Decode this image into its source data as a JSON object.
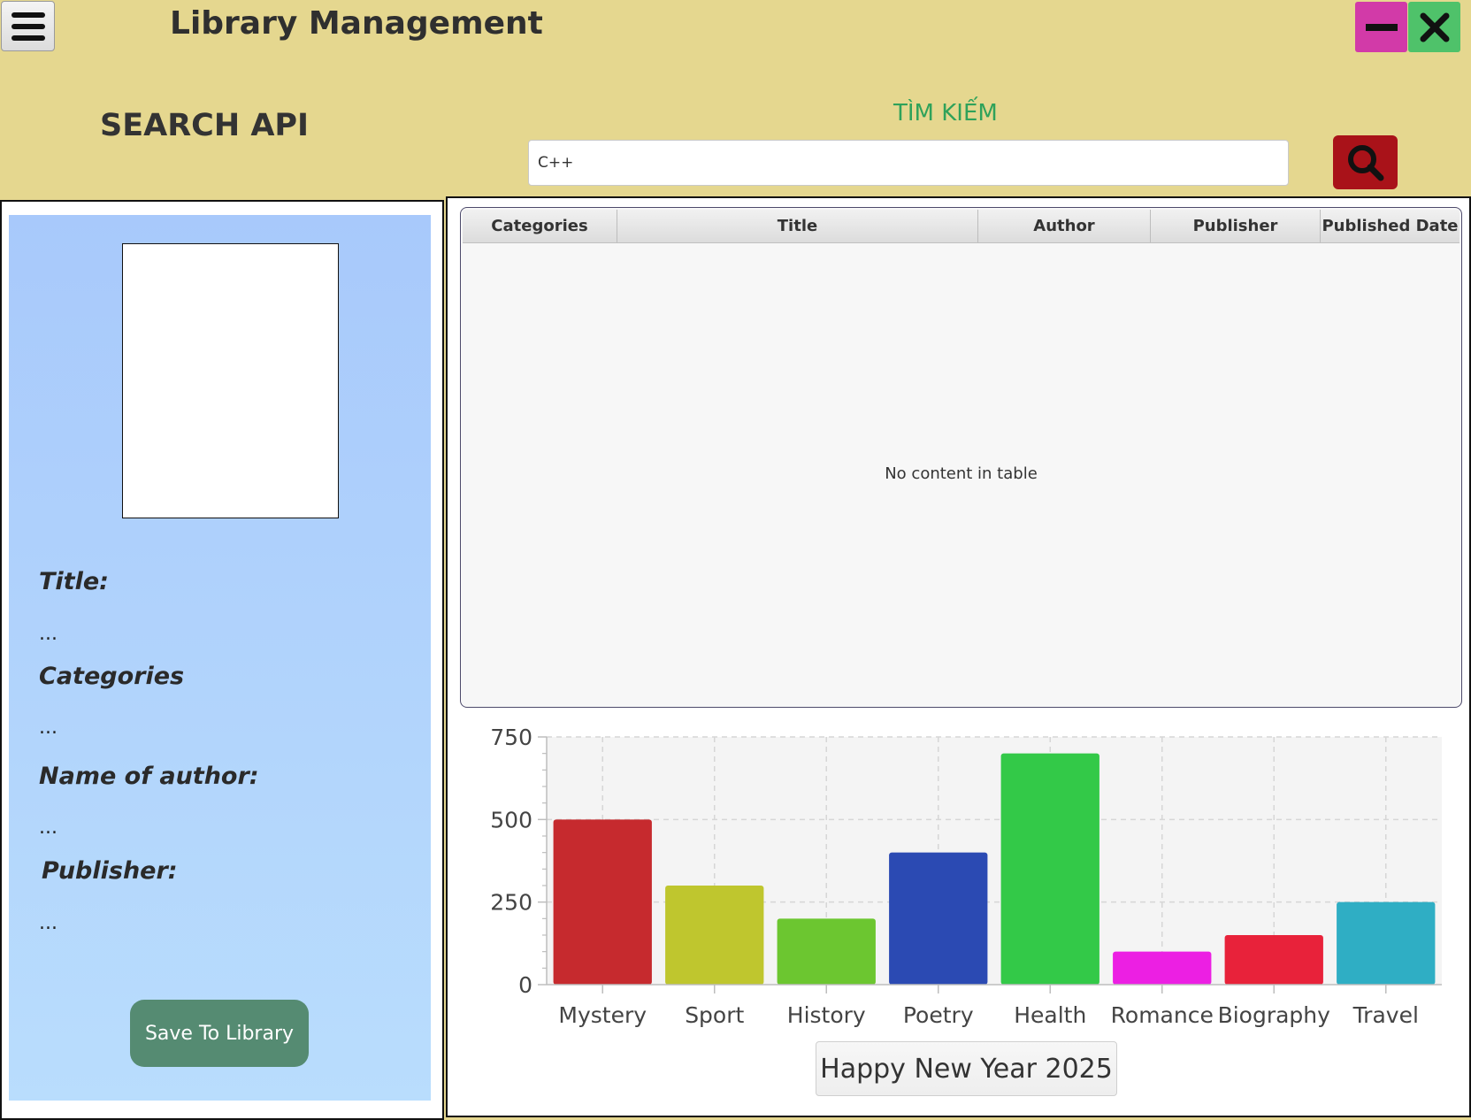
{
  "header": {
    "app_title": "Library Management",
    "menu_icon": "hamburger-icon",
    "minimize_icon": "minimize-icon",
    "close_icon": "close-icon"
  },
  "search": {
    "section_title": "SEARCH API",
    "label": "TÌM KIẾM",
    "value": "C++",
    "button_icon": "search-icon"
  },
  "details": {
    "title_label": "Title:",
    "title_value": "...",
    "categories_label": "Categories",
    "categories_value": "...",
    "author_label": "Name of author:",
    "author_value": "...",
    "publisher_label": "Publisher:",
    "publisher_value": "...",
    "save_button": "Save To Library"
  },
  "table": {
    "columns": [
      "Categories",
      "Title",
      "Author",
      "Publisher",
      "Published Date"
    ],
    "empty_message": "No content in table"
  },
  "chart_data": {
    "type": "bar",
    "categories": [
      "Mystery",
      "Sport",
      "History",
      "Poetry",
      "Health",
      "Romance",
      "Biography",
      "Travel"
    ],
    "values": [
      500,
      300,
      200,
      400,
      700,
      100,
      150,
      250
    ],
    "colors": [
      "#c62a2e",
      "#bfc62e",
      "#6cc630",
      "#2b4ab3",
      "#33c948",
      "#ec1fe3",
      "#e8223a",
      "#2faec4"
    ],
    "ylim": [
      0,
      750
    ],
    "yticks": [
      0,
      250,
      500,
      750
    ],
    "title": "",
    "xlabel": "",
    "ylabel": "",
    "grid": true,
    "legend": "none"
  },
  "footer": {
    "button_label": "Happy New Year 2025"
  },
  "colors": {
    "background": "#e5d78f",
    "minimize": "#d23aa8",
    "close": "#4fc26a",
    "search_button": "#a91219",
    "save_button": "#558b72",
    "search_label": "#2fa25a"
  }
}
